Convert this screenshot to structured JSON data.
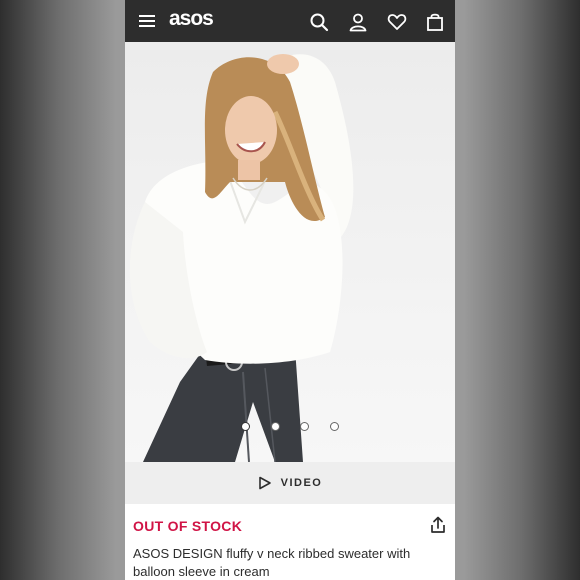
{
  "header": {
    "logo": "asos",
    "icons": [
      "menu-icon",
      "search-icon",
      "account-icon",
      "heart-icon",
      "bag-icon"
    ]
  },
  "gallery": {
    "image_count": 4,
    "active_index": 0
  },
  "video": {
    "label": "VIDEO",
    "icon": "play-icon"
  },
  "product": {
    "stock_status": "OUT OF STOCK",
    "stock_color": "#d01345",
    "title": "ASOS DESIGN fluffy v neck ribbed sweater with balloon sleeve in cream",
    "share_icon": "share-icon"
  }
}
